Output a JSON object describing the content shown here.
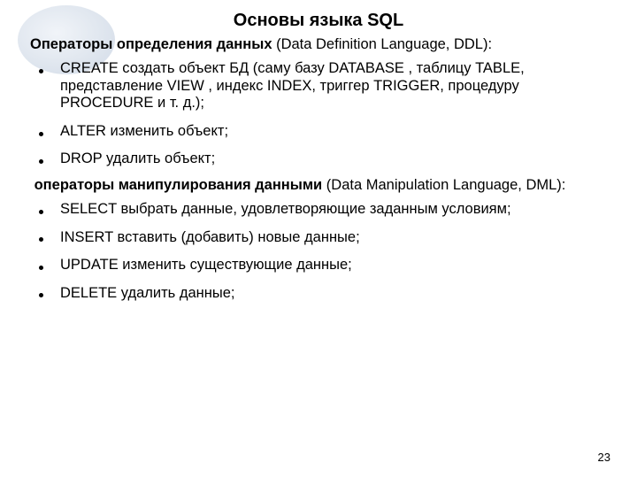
{
  "title": "Основы языка SQL",
  "ddl": {
    "head_bold": "Операторы определения данных",
    "head_rest": " (Data Definition Language, DDL):",
    "items": [
      "CREATE создать объект БД (саму базу DATABASE , таблицу TABLE, представление VIEW , индекс INDEX, триггер TRIGGER, процедуру PROCEDURE и т. д.);",
      "ALTER изменить объект;",
      "DROP удалить объект;"
    ]
  },
  "dml": {
    "head_bold": "операторы манипулирования данными",
    "head_rest": " (Data Manipulation Language, DML):",
    "items": [
      "SELECT выбрать данные, удовлетворяющие заданным условиям;",
      "INSERT вставить (добавить) новые данные;",
      "UPDATE изменить существующие данные;",
      "DELETE удалить данные;"
    ]
  },
  "page_number": "23"
}
